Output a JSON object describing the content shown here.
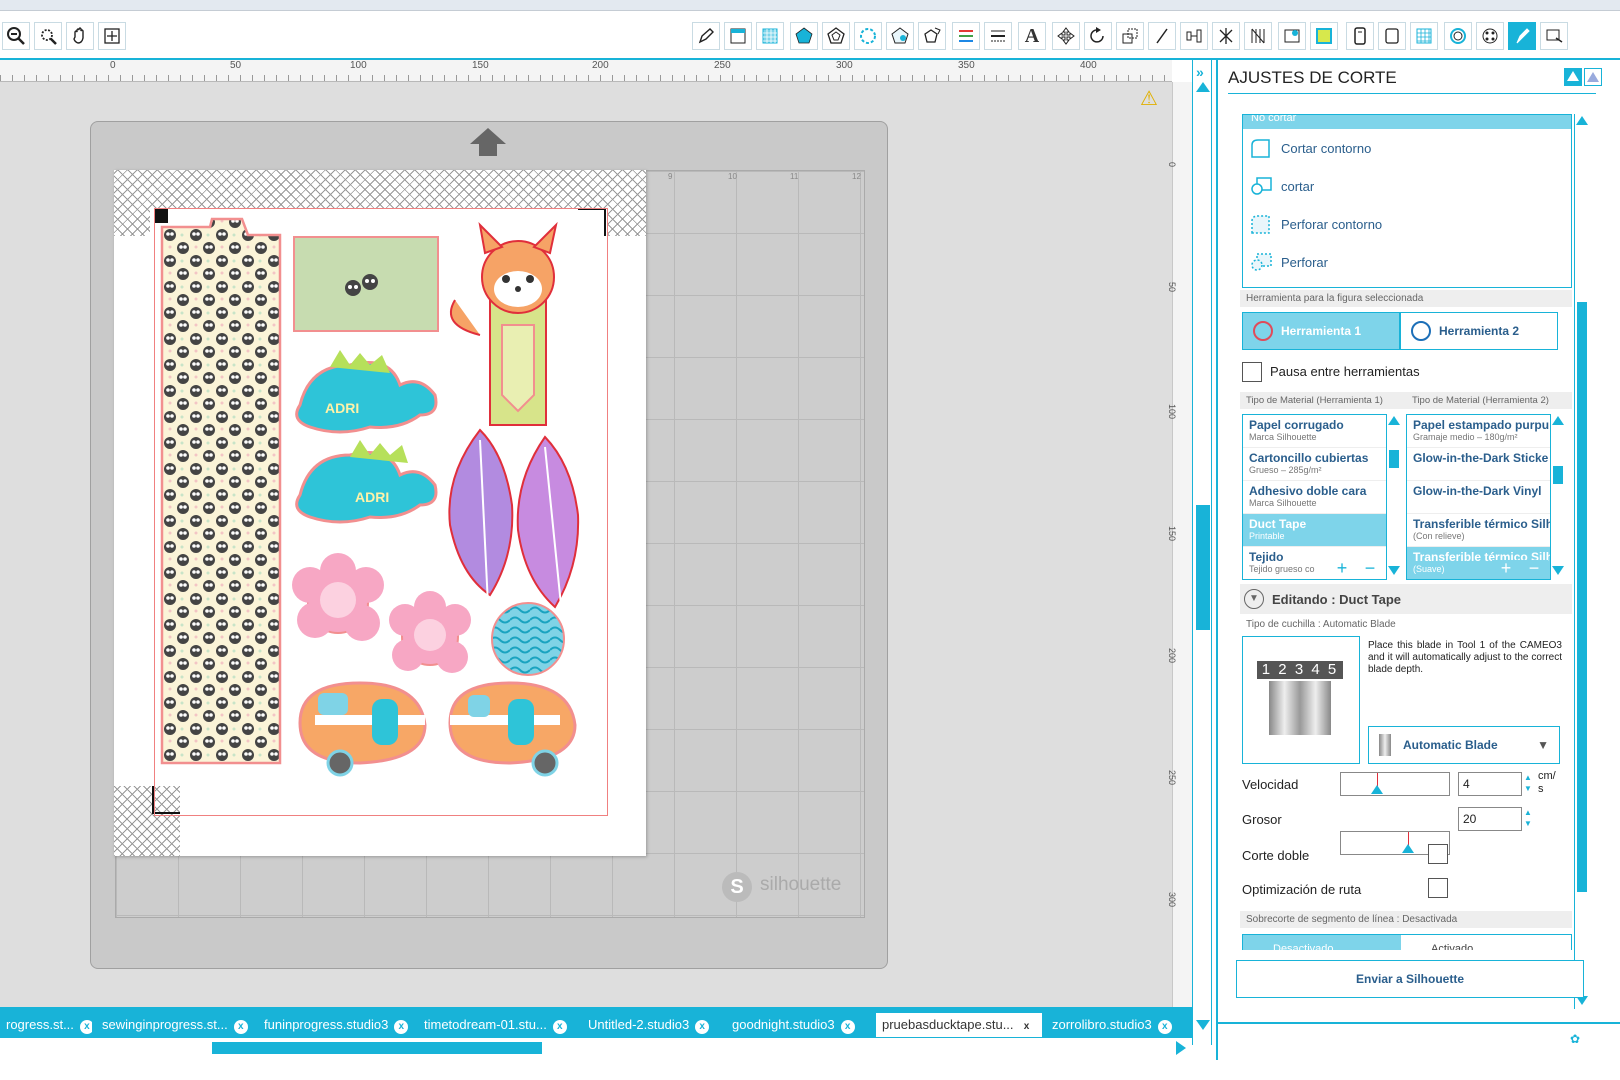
{
  "toolbar": {
    "left_tools": [
      "zoom-out-icon",
      "zoom-selection-icon",
      "pan-icon",
      "fit-page-icon"
    ],
    "right_tools": [
      "draw-icon",
      "page-settings-icon",
      "grid-icon",
      "fill-icon",
      "line-style-icon",
      "gradient-icon",
      "pattern-icon",
      "shadow-icon",
      "line-color-icon",
      "line-width-icon",
      "text-icon",
      "transform-icon",
      "rotate-icon",
      "scale-icon",
      "shear-icon",
      "align-icon",
      "replicate-icon",
      "modify-icon",
      "library-icon",
      "store-icon",
      "send-icon",
      "offset-icon",
      "trace-icon",
      "point-edit-icon",
      "design-tools-icon",
      "cut-settings-icon",
      "send-to-icon"
    ]
  },
  "ruler": {
    "labels": [
      "0",
      "50",
      "100",
      "150",
      "200",
      "250",
      "300",
      "350",
      "400"
    ],
    "v_labels": [
      "0",
      "50",
      "100",
      "150",
      "200",
      "250",
      "300"
    ]
  },
  "canvas": {
    "warning_icon": "warning-icon",
    "mat_logo": "silhouette",
    "mat_numbers": [
      "9",
      "10",
      "11",
      "12"
    ],
    "designs": {
      "label1": "ADRI",
      "label2": "ADRI"
    }
  },
  "panel": {
    "title": "AJUSTES DE CORTE",
    "cut_options": {
      "header_partial": "No cortar",
      "items": [
        "Cortar contorno",
        "cortar",
        "Perforar contorno",
        "Perforar"
      ]
    },
    "tool_section": "Herramienta para la figura seleccionada",
    "tool1": "Herramienta 1",
    "tool2": "Herramienta 2",
    "pause_label": "Pausa entre herramientas",
    "material1_header": "Tipo de Material (Herramienta 1)",
    "material2_header": "Tipo de Material (Herramienta 2)",
    "materials1": [
      {
        "t": "Papel corrugado",
        "s": "Marca Silhouette"
      },
      {
        "t": "Cartoncillo cubiertas",
        "s": "Grueso – 285g/m²"
      },
      {
        "t": "Adhesivo doble cara",
        "s": "Marca Silhouette"
      },
      {
        "t": "Duct Tape",
        "s": "Printable"
      },
      {
        "t": "Tejido",
        "s": "Tejido grueso co"
      }
    ],
    "materials2": [
      {
        "t": "Papel estampado purpu",
        "s": "Gramaje medio – 180g/m²"
      },
      {
        "t": "Glow-in-the-Dark Sticke",
        "s": ""
      },
      {
        "t": "Glow-in-the-Dark Vinyl",
        "s": ""
      },
      {
        "t": "Transferible térmico Silh",
        "s": "(Con relieve)"
      },
      {
        "t": "Transferible térmico Silh",
        "s": "(Suave)"
      }
    ],
    "editing_label": "Editando : Duct Tape",
    "blade_header": "Tipo de cuchilla : Automatic Blade",
    "blade_desc": "Place this blade in Tool 1 of the CAMEO3 and it will automatically adjust to the correct blade depth.",
    "blade_digits": "1 2 3 4 5",
    "blade_select": "Automatic Blade",
    "speed_label": "Velocidad",
    "speed_value": "4",
    "speed_unit": "cm/\ns",
    "speed_level": 0.33,
    "force_label": "Grosor",
    "force_value": "20",
    "force_level": 0.62,
    "double_cut_label": "Corte doble",
    "route_opt_label": "Optimización de ruta",
    "overcut_header": "Sobrecorte de segmento de línea : Desactivada",
    "overcut_off": "Desactivado",
    "overcut_on": "Activado",
    "send_button": "Enviar a Silhouette"
  },
  "tabs": [
    {
      "label": "rogress.st..."
    },
    {
      "label": "sewinginprogress.st..."
    },
    {
      "label": "funinprogress.studio3"
    },
    {
      "label": "timetodream-01.stu..."
    },
    {
      "label": "Untitled-2.studio3"
    },
    {
      "label": "goodnight.studio3"
    },
    {
      "label": "pruebasducktape.stu..."
    },
    {
      "label": "zorrolibro.studio3"
    }
  ],
  "colors": {
    "accent": "#18b3d8",
    "selected_row": "#7ed4ea"
  }
}
